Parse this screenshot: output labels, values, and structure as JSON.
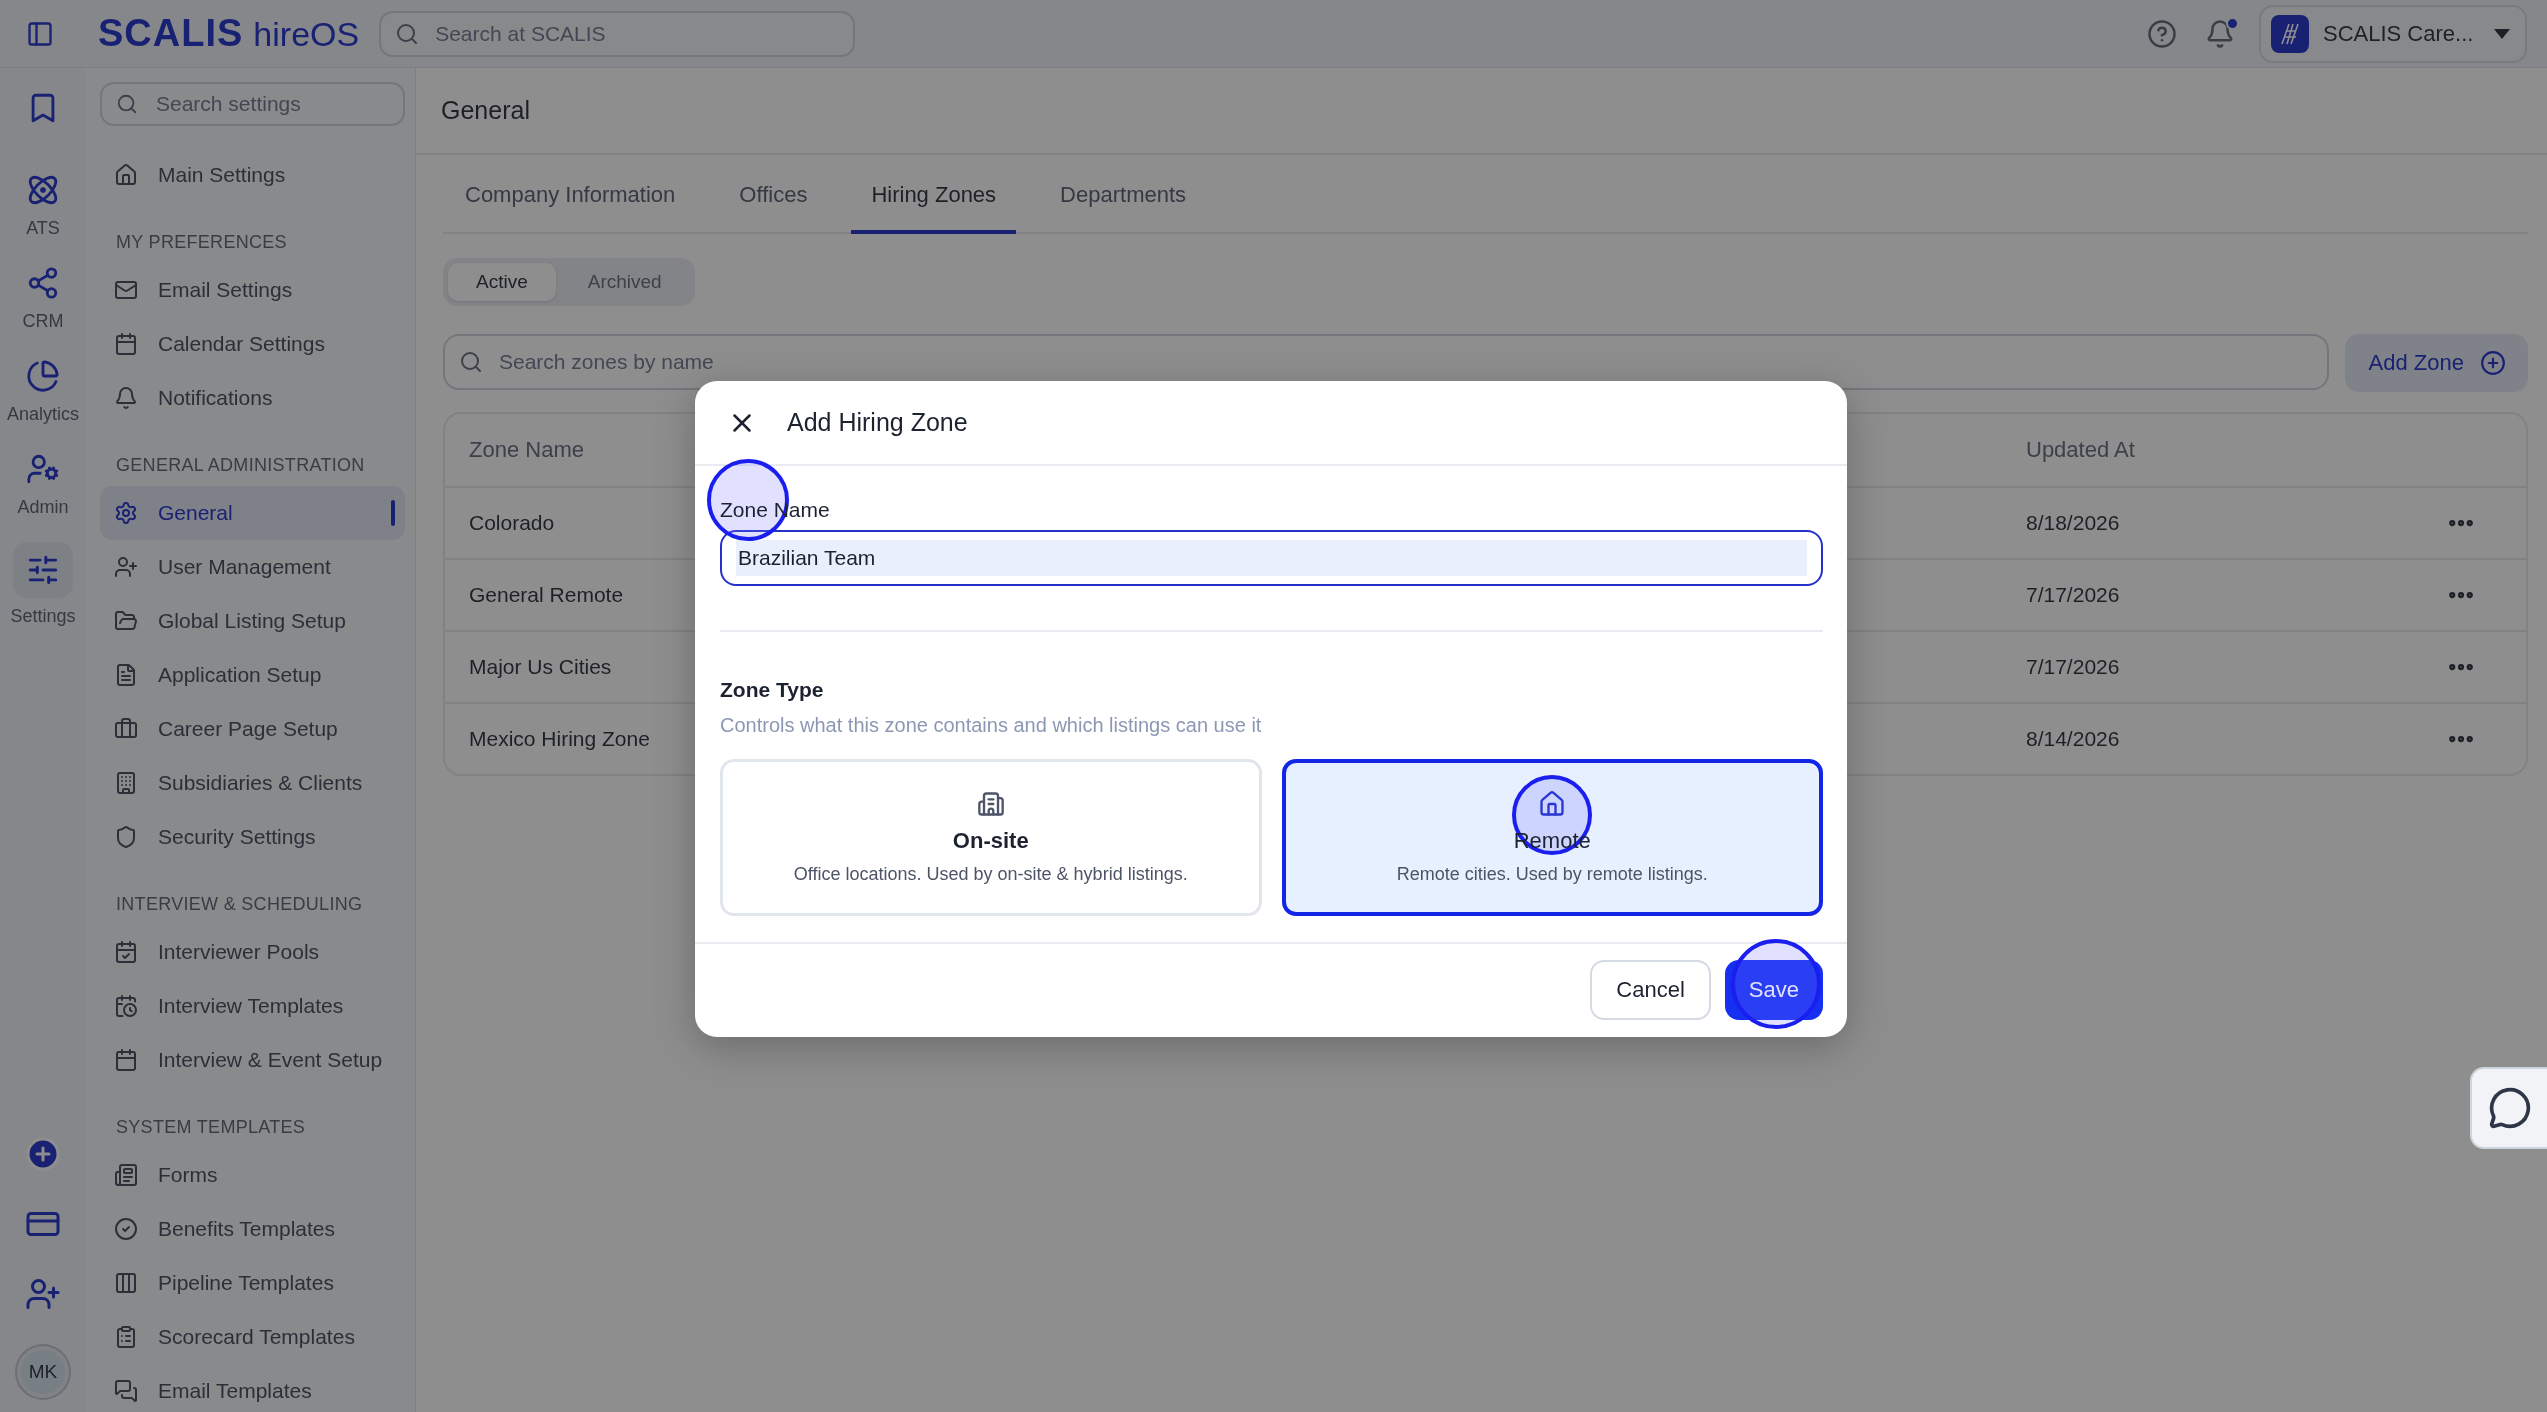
{
  "top_bar": {
    "logo": {
      "brand": "SCALIS",
      "product": "hireOS"
    },
    "search": {
      "placeholder": "Search at SCALIS"
    },
    "notifications": {
      "unread": true
    },
    "account": {
      "name": "SCALIS Care..."
    }
  },
  "rail": {
    "items": [
      {
        "selected": false
      },
      {
        "label": "ATS",
        "selected": false
      },
      {
        "label": "CRM",
        "selected": false
      },
      {
        "label": "Analytics",
        "selected": false
      },
      {
        "label": "Admin",
        "selected": false
      },
      {
        "label": "Settings",
        "selected": true
      }
    ],
    "avatar": "MK"
  },
  "sidebar": {
    "search": {
      "placeholder": "Search settings"
    },
    "main_item": {
      "label": "Main Settings",
      "selected": false
    },
    "sections": [
      {
        "title": "MY PREFERENCES",
        "items": [
          {
            "label": "Email Settings",
            "selected": false
          },
          {
            "label": "Calendar Settings",
            "selected": false
          },
          {
            "label": "Notifications",
            "selected": false
          }
        ]
      },
      {
        "title": "GENERAL ADMINISTRATION",
        "items": [
          {
            "label": "General",
            "selected": true
          },
          {
            "label": "User Management",
            "selected": false
          },
          {
            "label": "Global Listing Setup",
            "selected": false
          },
          {
            "label": "Application Setup",
            "selected": false
          },
          {
            "label": "Career Page Setup",
            "selected": false
          },
          {
            "label": "Subsidiaries & Clients",
            "selected": false
          },
          {
            "label": "Security Settings",
            "selected": false
          }
        ]
      },
      {
        "title": "INTERVIEW & SCHEDULING",
        "items": [
          {
            "label": "Interviewer Pools",
            "selected": false
          },
          {
            "label": "Interview Templates",
            "selected": false
          },
          {
            "label": "Interview & Event Setup",
            "selected": false
          }
        ]
      },
      {
        "title": "SYSTEM TEMPLATES",
        "items": [
          {
            "label": "Forms",
            "selected": false
          },
          {
            "label": "Benefits Templates",
            "selected": false
          },
          {
            "label": "Pipeline Templates",
            "selected": false
          },
          {
            "label": "Scorecard Templates",
            "selected": false
          },
          {
            "label": "Email Templates",
            "selected": false
          }
        ]
      }
    ]
  },
  "page": {
    "title": "General",
    "tabs": [
      {
        "label": "Company Information",
        "selected": false
      },
      {
        "label": "Offices",
        "selected": false
      },
      {
        "label": "Hiring Zones",
        "selected": true
      },
      {
        "label": "Departments",
        "selected": false
      }
    ],
    "filters": [
      {
        "label": "Active",
        "selected": true
      },
      {
        "label": "Archived",
        "selected": false
      }
    ],
    "search": {
      "placeholder": "Search zones by name"
    },
    "add_button": "Add Zone",
    "table": {
      "columns": [
        "Zone Name",
        "Updated At"
      ],
      "rows": [
        {
          "name": "Colorado",
          "updated_at": "8/18/2026"
        },
        {
          "name": "General Remote",
          "updated_at": "7/17/2026"
        },
        {
          "name": "Major Us Cities",
          "updated_at": "7/17/2026"
        },
        {
          "name": "Mexico Hiring Zone",
          "updated_at": "8/14/2026"
        }
      ]
    }
  },
  "dialog": {
    "title": "Add Hiring Zone",
    "field": {
      "label": "Zone Name",
      "value": "Brazilian Team"
    },
    "zone_type": {
      "title": "Zone Type",
      "description": "Controls what this zone contains and which listings can use it",
      "options": [
        {
          "kind": "onsite",
          "title": "On-site",
          "description": "Office locations. Used by on-site & hybrid listings.",
          "selected": false
        },
        {
          "kind": "remote",
          "title": "Remote",
          "description": "Remote cities. Used by remote listings.",
          "selected": true
        }
      ]
    },
    "buttons": {
      "cancel": "Cancel",
      "save": "Save"
    }
  }
}
